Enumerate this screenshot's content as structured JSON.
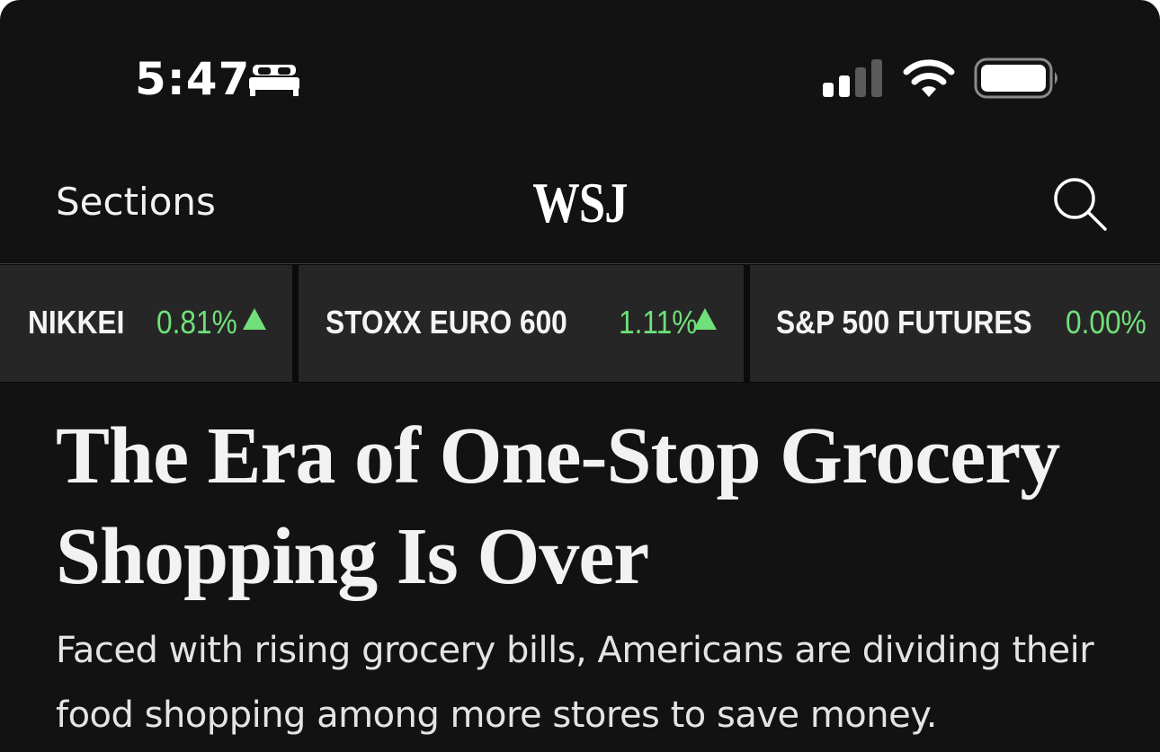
{
  "status_bar": {
    "time": "5:47",
    "focus_icon": "bed-icon",
    "signal_icon": "cellular-signal-icon",
    "wifi_icon": "wifi-icon",
    "battery_icon": "battery-icon"
  },
  "nav": {
    "sections_label": "Sections",
    "logo": "WSJ",
    "search_icon": "search-icon"
  },
  "ticker": {
    "items": [
      {
        "name": "NIKKEI",
        "change": "0.81%",
        "direction": "up"
      },
      {
        "name": "STOXX EURO 600",
        "change": "1.11%",
        "direction": "up"
      },
      {
        "name": "S&P 500 FUTURES",
        "change": "0.00%",
        "direction": "none"
      }
    ]
  },
  "article": {
    "headline": "The Era of One-Stop Grocery Shopping Is Over",
    "summary": "Faced with rising grocery bills, Americans are dividing their food shopping among more stores to save money."
  },
  "colors": {
    "background": "#121212",
    "ticker_tile": "#262626",
    "positive": "#70e07a",
    "text": "#f2f2f2"
  }
}
